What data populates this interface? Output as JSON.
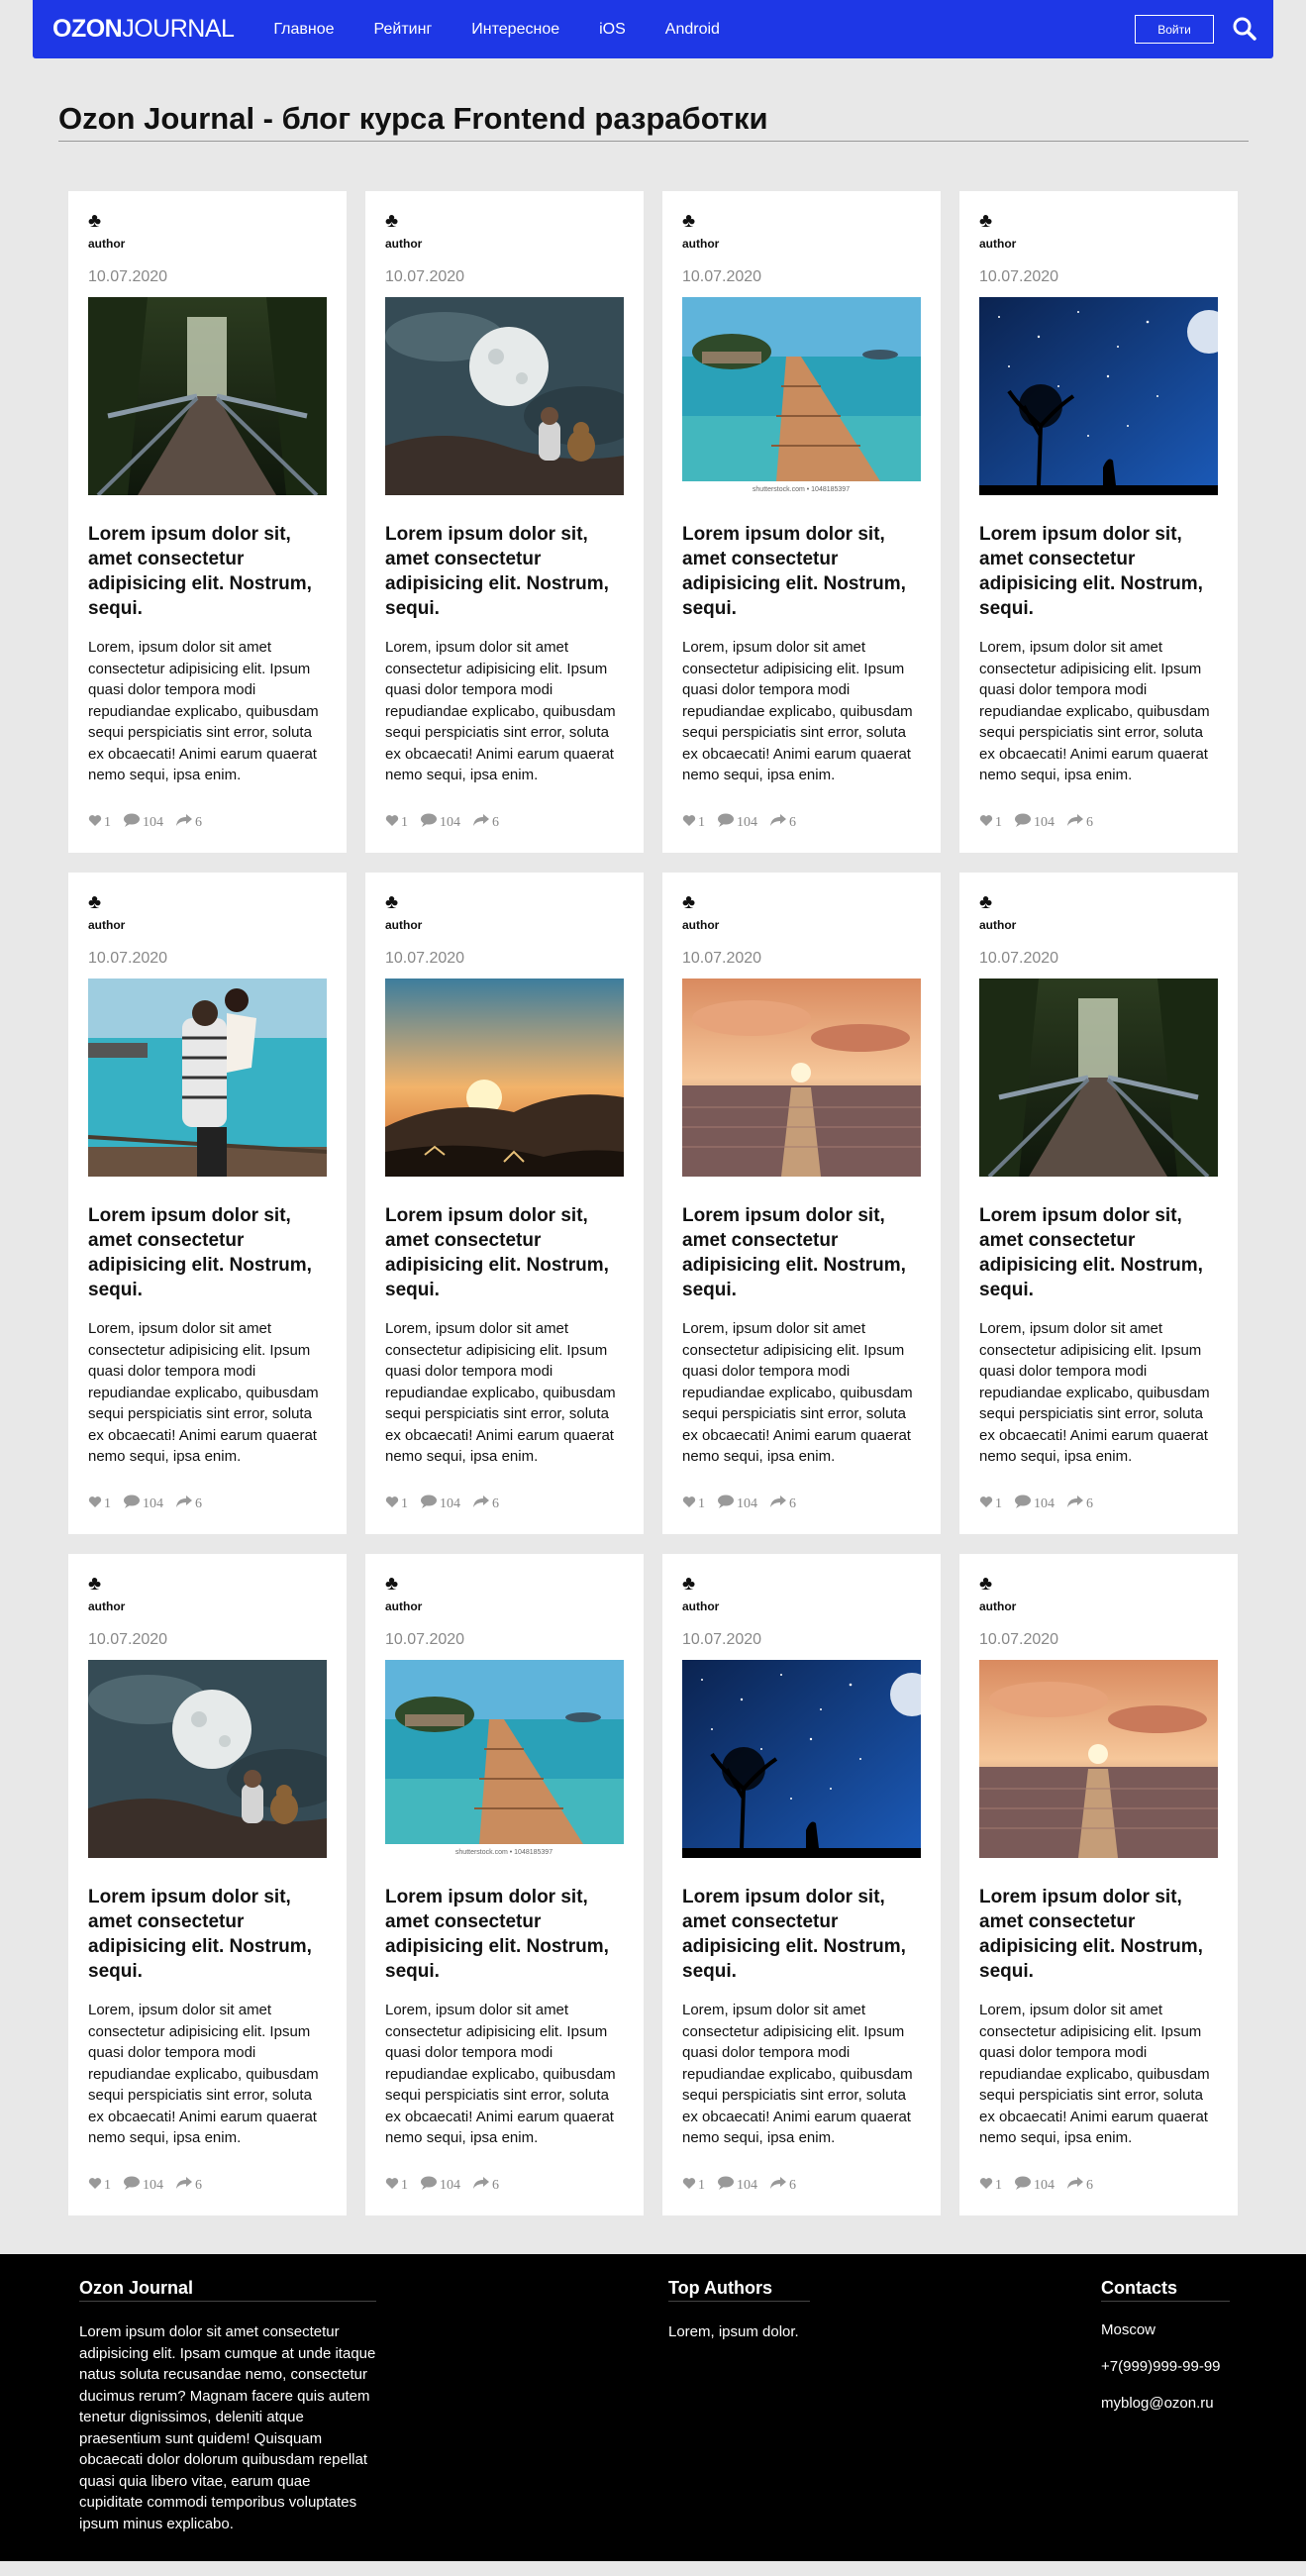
{
  "header": {
    "logo_bold": "OZON",
    "logo_thin": "JOURNAL",
    "nav": [
      "Главное",
      "Рейтинг",
      "Интересное",
      "iOS",
      "Android"
    ],
    "login_label": "Войти",
    "search_icon": "search-icon"
  },
  "page": {
    "title": "Ozon Journal - блог курса Frontend разработки"
  },
  "cards": [
    {
      "club": "♣",
      "author": "author",
      "date": "10.07.2020",
      "image": "forest-bridge",
      "title": "Lorem ipsum dolor sit, amet consectetur adipisicing elit. Nostrum, sequi.",
      "text": "Lorem, ipsum dolor sit amet consectetur adipisicing elit. Ipsum quasi dolor tempora modi repudiandae explicabo, quibusdam sequi perspiciatis sint error, soluta ex obcaecati! Animi earum quaerat nemo sequi, ipsa enim.",
      "likes": "1",
      "comments": "104",
      "shares": "6"
    },
    {
      "club": "♣",
      "author": "author",
      "date": "10.07.2020",
      "image": "moon-child",
      "title": "Lorem ipsum dolor sit, amet consectetur adipisicing elit. Nostrum, sequi.",
      "text": "Lorem, ipsum dolor sit amet consectetur adipisicing elit. Ipsum quasi dolor tempora modi repudiandae explicabo, quibusdam sequi perspiciatis sint error, soluta ex obcaecati! Animi earum quaerat nemo sequi, ipsa enim.",
      "likes": "1",
      "comments": "104",
      "shares": "6"
    },
    {
      "club": "♣",
      "author": "author",
      "date": "10.07.2020",
      "image": "pier-island",
      "caption": "shutterstock.com • 1048185397",
      "title": "Lorem ipsum dolor sit, amet consectetur adipisicing elit. Nostrum, sequi.",
      "text": "Lorem, ipsum dolor sit amet consectetur adipisicing elit. Ipsum quasi dolor tempora modi repudiandae explicabo, quibusdam sequi perspiciatis sint error, soluta ex obcaecati! Animi earum quaerat nemo sequi, ipsa enim.",
      "likes": "1",
      "comments": "104",
      "shares": "6"
    },
    {
      "club": "♣",
      "author": "author",
      "date": "10.07.2020",
      "image": "night-tree",
      "title": "Lorem ipsum dolor sit, amet consectetur adipisicing elit. Nostrum, sequi.",
      "text": "Lorem, ipsum dolor sit amet consectetur adipisicing elit. Ipsum quasi dolor tempora modi repudiandae explicabo, quibusdam sequi perspiciatis sint error, soluta ex obcaecati! Animi earum quaerat nemo sequi, ipsa enim.",
      "likes": "1",
      "comments": "104",
      "shares": "6"
    },
    {
      "club": "♣",
      "author": "author",
      "date": "10.07.2020",
      "image": "couple-beach",
      "title": "Lorem ipsum dolor sit, amet consectetur adipisicing elit. Nostrum, sequi.",
      "text": "Lorem, ipsum dolor sit amet consectetur adipisicing elit. Ipsum quasi dolor tempora modi repudiandae explicabo, quibusdam sequi perspiciatis sint error, soluta ex obcaecati! Animi earum quaerat nemo sequi, ipsa enim.",
      "likes": "1",
      "comments": "104",
      "shares": "6"
    },
    {
      "club": "♣",
      "author": "author",
      "date": "10.07.2020",
      "image": "sunset-hills",
      "title": "Lorem ipsum dolor sit, amet consectetur adipisicing elit. Nostrum, sequi.",
      "text": "Lorem, ipsum dolor sit amet consectetur adipisicing elit. Ipsum quasi dolor tempora modi repudiandae explicabo, quibusdam sequi perspiciatis sint error, soluta ex obcaecati! Animi earum quaerat nemo sequi, ipsa enim.",
      "likes": "1",
      "comments": "104",
      "shares": "6"
    },
    {
      "club": "♣",
      "author": "author",
      "date": "10.07.2020",
      "image": "sea-sunset",
      "title": "Lorem ipsum dolor sit, amet consectetur adipisicing elit. Nostrum, sequi.",
      "text": "Lorem, ipsum dolor sit amet consectetur adipisicing elit. Ipsum quasi dolor tempora modi repudiandae explicabo, quibusdam sequi perspiciatis sint error, soluta ex obcaecati! Animi earum quaerat nemo sequi, ipsa enim.",
      "likes": "1",
      "comments": "104",
      "shares": "6"
    },
    {
      "club": "♣",
      "author": "author",
      "date": "10.07.2020",
      "image": "forest-bridge",
      "title": "Lorem ipsum dolor sit, amet consectetur adipisicing elit. Nostrum, sequi.",
      "text": "Lorem, ipsum dolor sit amet consectetur adipisicing elit. Ipsum quasi dolor tempora modi repudiandae explicabo, quibusdam sequi perspiciatis sint error, soluta ex obcaecati! Animi earum quaerat nemo sequi, ipsa enim.",
      "likes": "1",
      "comments": "104",
      "shares": "6"
    },
    {
      "club": "♣",
      "author": "author",
      "date": "10.07.2020",
      "image": "moon-child",
      "title": "Lorem ipsum dolor sit, amet consectetur adipisicing elit. Nostrum, sequi.",
      "text": "Lorem, ipsum dolor sit amet consectetur adipisicing elit. Ipsum quasi dolor tempora modi repudiandae explicabo, quibusdam sequi perspiciatis sint error, soluta ex obcaecati! Animi earum quaerat nemo sequi, ipsa enim.",
      "likes": "1",
      "comments": "104",
      "shares": "6"
    },
    {
      "club": "♣",
      "author": "author",
      "date": "10.07.2020",
      "image": "pier-island",
      "caption": "shutterstock.com • 1048185397",
      "title": "Lorem ipsum dolor sit, amet consectetur adipisicing elit. Nostrum, sequi.",
      "text": "Lorem, ipsum dolor sit amet consectetur adipisicing elit. Ipsum quasi dolor tempora modi repudiandae explicabo, quibusdam sequi perspiciatis sint error, soluta ex obcaecati! Animi earum quaerat nemo sequi, ipsa enim.",
      "likes": "1",
      "comments": "104",
      "shares": "6"
    },
    {
      "club": "♣",
      "author": "author",
      "date": "10.07.2020",
      "image": "night-tree",
      "title": "Lorem ipsum dolor sit, amet consectetur adipisicing elit. Nostrum, sequi.",
      "text": "Lorem, ipsum dolor sit amet consectetur adipisicing elit. Ipsum quasi dolor tempora modi repudiandae explicabo, quibusdam sequi perspiciatis sint error, soluta ex obcaecati! Animi earum quaerat nemo sequi, ipsa enim.",
      "likes": "1",
      "comments": "104",
      "shares": "6"
    },
    {
      "club": "♣",
      "author": "author",
      "date": "10.07.2020",
      "image": "sea-sunset",
      "title": "Lorem ipsum dolor sit, amet consectetur adipisicing elit. Nostrum, sequi.",
      "text": "Lorem, ipsum dolor sit amet consectetur adipisicing elit. Ipsum quasi dolor tempora modi repudiandae explicabo, quibusdam sequi perspiciatis sint error, soluta ex obcaecati! Animi earum quaerat nemo sequi, ipsa enim.",
      "likes": "1",
      "comments": "104",
      "shares": "6"
    }
  ],
  "icons": {
    "like": "heart-icon",
    "comment": "comment-icon",
    "share": "share-icon",
    "club": "club-icon"
  },
  "footer": {
    "about_title": "Ozon Journal",
    "about_text": "Lorem ipsum dolor sit amet consectetur adipisicing elit. Ipsam cumque at unde itaque natus soluta recusandae nemo, consectetur ducimus rerum? Magnam facere quis autem tenetur dignissimos, deleniti atque praesentium sunt quidem! Quisquam obcaecati dolor dolorum quibusdam repellat quasi quia libero vitae, earum quae cupiditate commodi temporibus voluptates ipsum minus explicabo.",
    "authors_title": "Top Authors",
    "authors_text": "Lorem, ipsum dolor.",
    "contacts_title": "Contacts",
    "city": "Moscow",
    "phone": "+7(999)999-99-99",
    "email": "myblog@ozon.ru"
  },
  "colors": {
    "header": "#1e37e6",
    "background": "#e8e8e8",
    "footer": "#000000",
    "meta": "#888888"
  }
}
